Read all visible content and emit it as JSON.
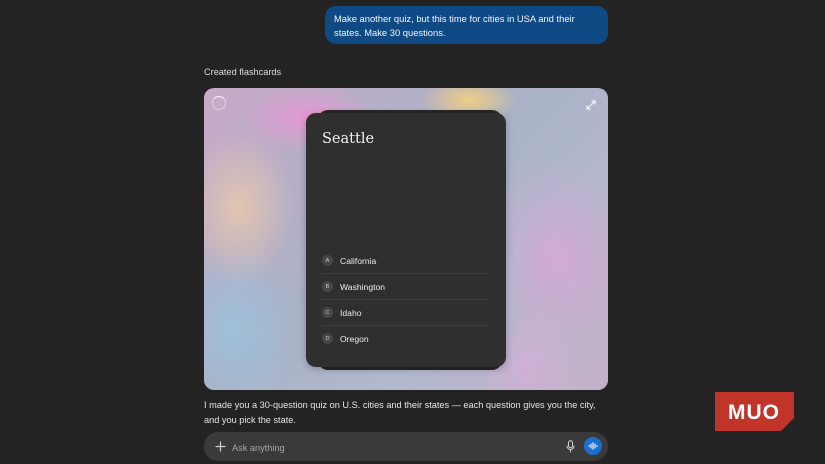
{
  "user_message": "Make another quiz, but this time for cities in USA and their states. Make 30 questions.",
  "status": "Created flashcards",
  "flashcard": {
    "question": "Seattle",
    "options": [
      {
        "letter": "A",
        "label": "California"
      },
      {
        "letter": "B",
        "label": "Washington"
      },
      {
        "letter": "C",
        "label": "Idaho"
      },
      {
        "letter": "D",
        "label": "Oregon"
      }
    ]
  },
  "assistant_response": "I made you a 30-question quiz on U.S. cities and their states — each question gives you the city, and you pick the state.",
  "composer": {
    "placeholder": "Ask anything"
  },
  "watermark": "MUO",
  "icons": {
    "loading": "spinner-icon",
    "expand": "expand-icon",
    "add": "plus-icon",
    "microphone": "microphone-icon",
    "voice": "voice-mode-icon"
  },
  "colors": {
    "background": "#232323",
    "user_bubble": "#0f4a84",
    "card": "#2f2f2f",
    "accent": "#1a6fd0",
    "logo": "#c0342a"
  }
}
